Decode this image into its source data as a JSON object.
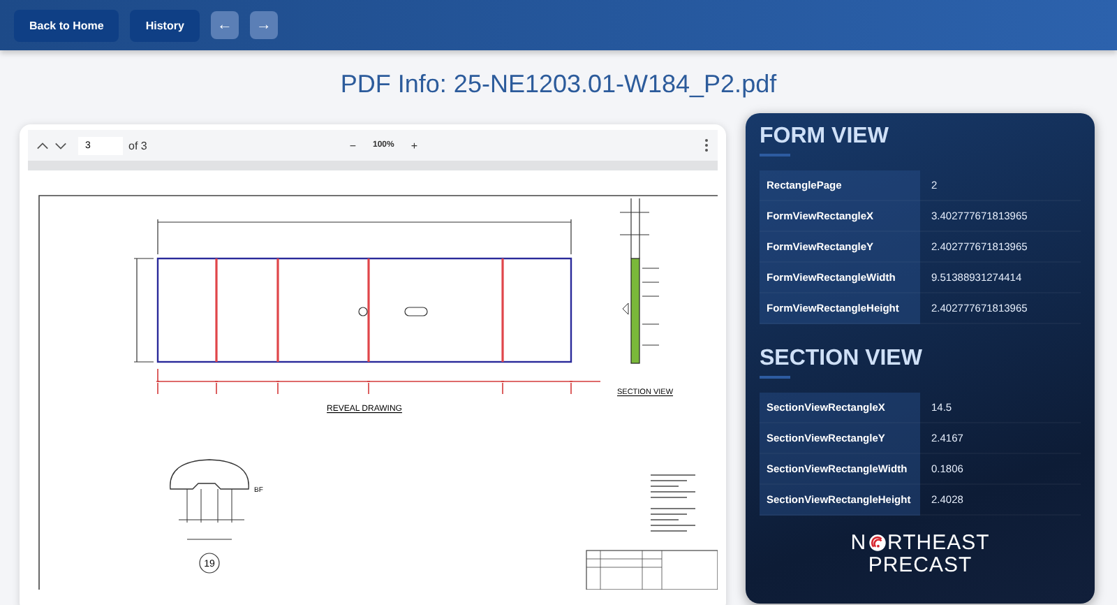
{
  "header": {
    "buttons": [
      {
        "label": "Back to Home",
        "kind": "text"
      },
      {
        "label": "History",
        "kind": "text"
      },
      {
        "label": "←",
        "kind": "arrow"
      },
      {
        "label": "→",
        "kind": "arrow"
      }
    ]
  },
  "title": "PDF Info: 25-NE1203.01-W184_P2.pdf",
  "viewer": {
    "page": "3",
    "page_count": "of 3",
    "zoom_out": "−",
    "zoom": "100%",
    "zoom_in": "+",
    "drawing": {
      "reveal_label": "REVEAL DRAWING",
      "section_label": "SECTION VIEW",
      "detail_number": "19",
      "detail_label": "BF"
    }
  },
  "sections": [
    {
      "heading": "FORM VIEW",
      "rows": [
        {
          "key": "RectanglePage",
          "value": "2"
        },
        {
          "key": "FormViewRectangleX",
          "value": "3.402777671813965"
        },
        {
          "key": "FormViewRectangleY",
          "value": "2.402777671813965"
        },
        {
          "key": "FormViewRectangleWidth",
          "value": "9.51388931274414"
        },
        {
          "key": "FormViewRectangleHeight",
          "value": "2.402777671813965"
        }
      ]
    },
    {
      "heading": "SECTION VIEW",
      "rows": [
        {
          "key": "SectionViewRectangleX",
          "value": "14.5"
        },
        {
          "key": "SectionViewRectangleY",
          "value": "2.4167"
        },
        {
          "key": "SectionViewRectangleWidth",
          "value": "0.1806"
        },
        {
          "key": "SectionViewRectangleHeight",
          "value": "2.4028"
        }
      ]
    }
  ],
  "logo": {
    "before": "N",
    "after": "RTHEAST",
    "line2": "PRECAST"
  }
}
